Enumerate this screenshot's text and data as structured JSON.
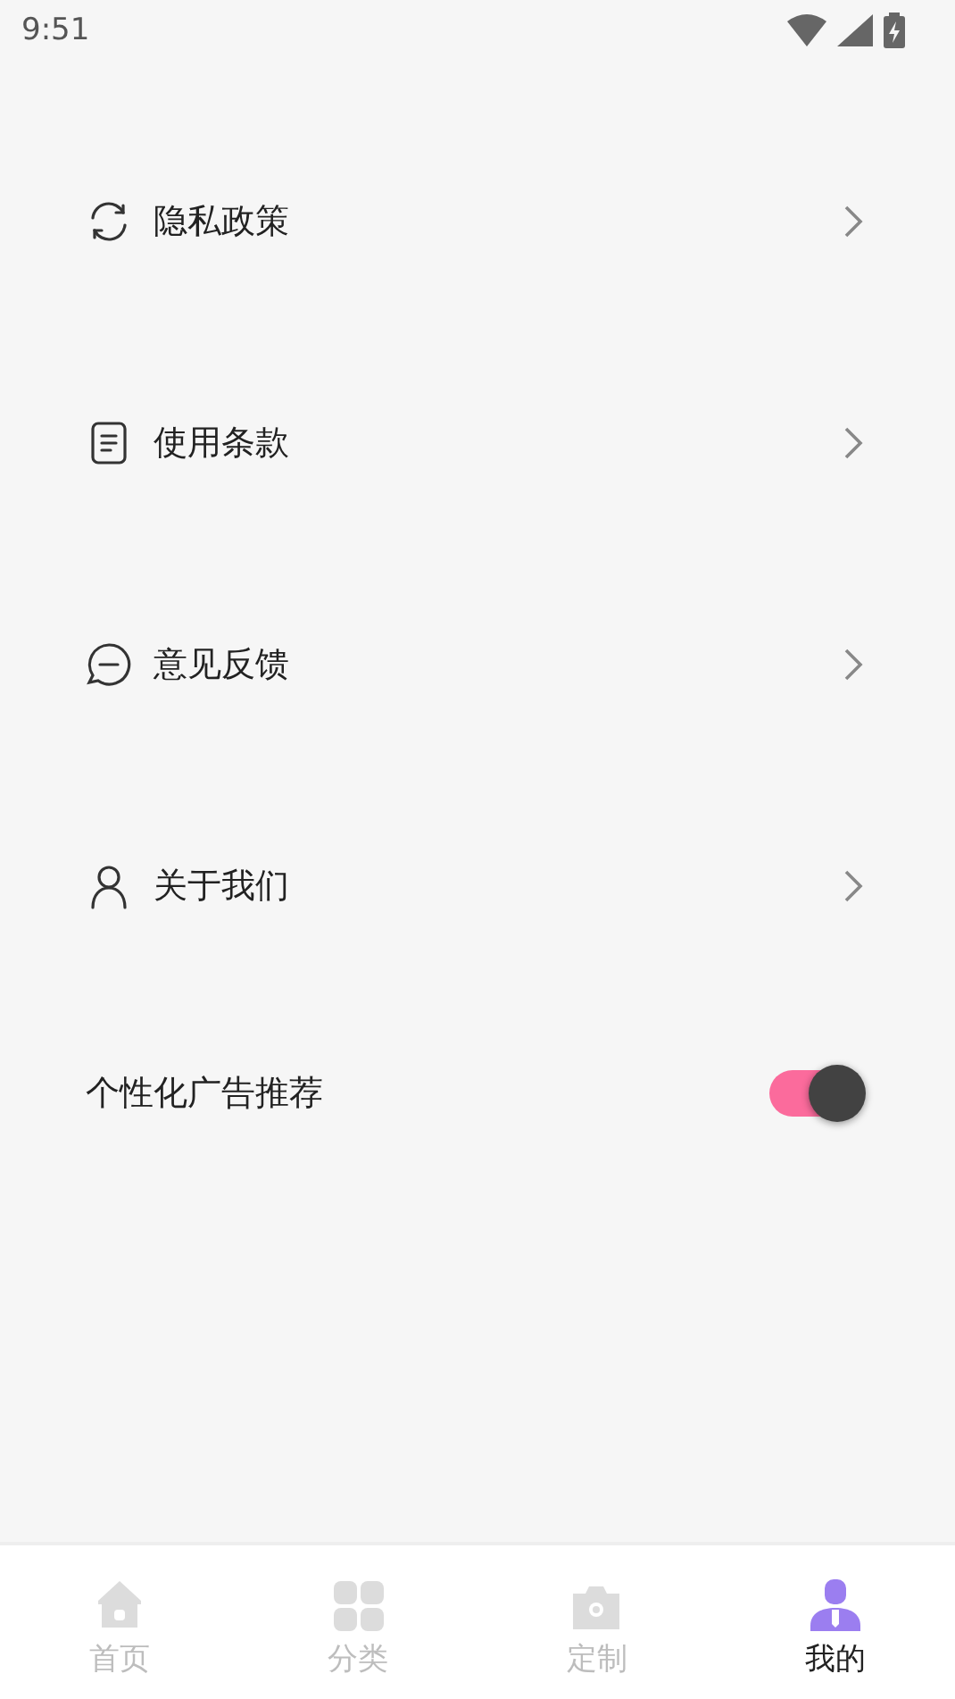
{
  "status_bar": {
    "time": "9:51"
  },
  "menu": [
    {
      "kind": "refresh",
      "label": "隐私政策"
    },
    {
      "kind": "document",
      "label": "使用条款"
    },
    {
      "kind": "chat",
      "label": "意见反馈"
    },
    {
      "kind": "person",
      "label": "关于我们"
    }
  ],
  "ad_setting": {
    "label": "个性化广告推荐",
    "on": true
  },
  "tabs": [
    {
      "kind": "home",
      "label": "首页",
      "selected": false
    },
    {
      "kind": "grid",
      "label": "分类",
      "selected": false
    },
    {
      "kind": "camera",
      "label": "定制",
      "selected": false
    },
    {
      "kind": "user",
      "label": "我的",
      "selected": true
    }
  ]
}
